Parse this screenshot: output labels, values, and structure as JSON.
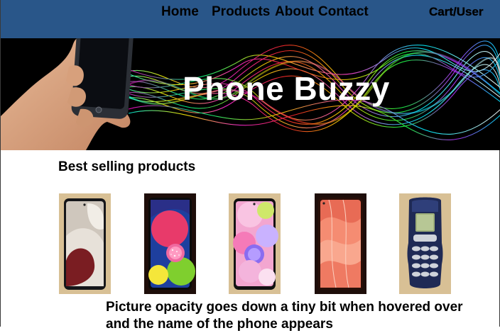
{
  "nav": {
    "home": "Home",
    "products": "Products",
    "about": "About",
    "contact": "Contact",
    "cart_user": "Cart/User"
  },
  "hero": {
    "title": "Phone Buzzy"
  },
  "products_section": {
    "heading": "Best selling products",
    "items": [
      {
        "image": "phone-white-blobs"
      },
      {
        "image": "phone-pink-sphere"
      },
      {
        "image": "phone-pastel-bubble"
      },
      {
        "image": "phone-coral-waves"
      },
      {
        "image": "phone-nokia-keypad"
      }
    ]
  },
  "note": "Picture opacity goes down a tiny bit when hovered over and the name of the phone appears",
  "colors": {
    "navbar": "#295689",
    "hero_background": "#000000",
    "card_beige": "#d8c095",
    "card_dark": "#1e0e0a"
  }
}
